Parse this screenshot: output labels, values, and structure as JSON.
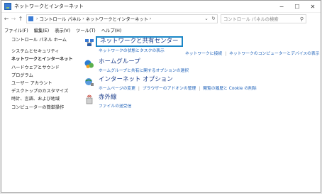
{
  "window": {
    "title": "ネットワークとインターネット"
  },
  "titlebar": {
    "minimize": "−",
    "maximize": "☐",
    "close": "✕"
  },
  "address": {
    "back": "←",
    "forward": "→",
    "up": "↑",
    "crumbs": [
      "コントロール パネル",
      "ネットワークとインターネット"
    ],
    "sep": "›",
    "dropdown": "⌄",
    "refresh": "↻",
    "search_placeholder": "コントロール パネルの検索"
  },
  "menu": [
    "ファイル(F)",
    "編集(E)",
    "表示(V)",
    "ツール(T)",
    "ヘルプ(H)"
  ],
  "sidebar": {
    "home": "コントロール パネル ホーム",
    "items": [
      {
        "label": "システムとセキュリティ",
        "active": false
      },
      {
        "label": "ネットワークとインターネット",
        "active": true
      },
      {
        "label": "ハードウェアとサウンド",
        "active": false
      },
      {
        "label": "プログラム",
        "active": false
      },
      {
        "label": "ユーザー アカウント",
        "active": false
      },
      {
        "label": "デスクトップのカスタマイズ",
        "active": false
      },
      {
        "label": "時計、言語、および地域",
        "active": false
      },
      {
        "label": "コンピューターの簡単操作",
        "active": false
      }
    ]
  },
  "categories": {
    "network": {
      "title": "ネットワークと共有センター",
      "links": [
        "ネットワークの状態とタスクの表示",
        "ネットワークに接続",
        "ネットワークのコンピューターとデバイスの表示"
      ]
    },
    "homegroup": {
      "title": "ホームグループ",
      "links": [
        "ホームグループと共有に関するオプションの選択"
      ]
    },
    "internet": {
      "title": "インターネット オプション",
      "links": [
        "ホームページの変更",
        "ブラウザーのアドオンの管理",
        "閲覧の履歴と Cookie の削除"
      ]
    },
    "infrared": {
      "title": "赤外線",
      "links": [
        "ファイルの送受信"
      ]
    }
  },
  "colors": {
    "accent": "#1a86c6",
    "link": "#1b5fb8",
    "heading": "#1a3c8a"
  }
}
